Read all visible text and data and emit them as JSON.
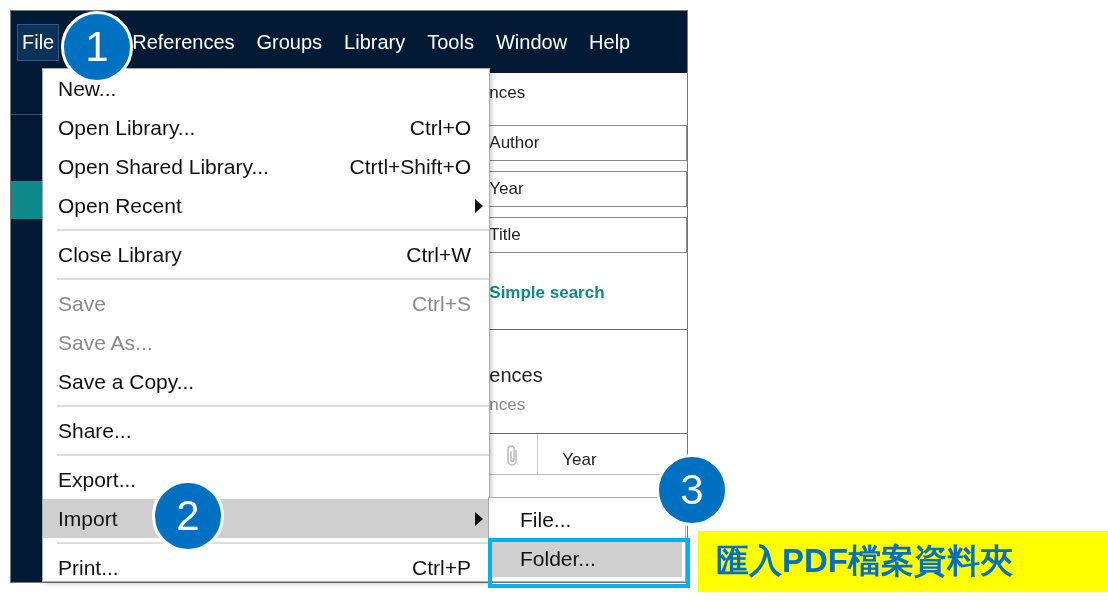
{
  "menu_bar": [
    {
      "label": "File",
      "selected": true
    },
    {
      "label": "References",
      "selected": false
    },
    {
      "label": "Groups",
      "selected": false
    },
    {
      "label": "Library",
      "selected": false
    },
    {
      "label": "Tools",
      "selected": false
    },
    {
      "label": "Window",
      "selected": false
    },
    {
      "label": "Help",
      "selected": false
    }
  ],
  "file_menu": [
    {
      "kind": "item",
      "label": "New...",
      "disabled": false,
      "selected": false,
      "submenu": false
    },
    {
      "kind": "item",
      "label": "Open Library...",
      "shortcut": "Ctrl+O",
      "disabled": false,
      "selected": false,
      "submenu": false
    },
    {
      "kind": "item",
      "label": "Open Shared Library...",
      "shortcut": "Ctrtl+Shift+O",
      "disabled": false,
      "selected": false,
      "submenu": false
    },
    {
      "kind": "item",
      "label": "Open Recent",
      "disabled": false,
      "selected": false,
      "submenu": true
    },
    {
      "kind": "separator"
    },
    {
      "kind": "item",
      "label": "Close Library",
      "shortcut": "Ctrl+W",
      "disabled": false,
      "selected": false,
      "submenu": false
    },
    {
      "kind": "separator"
    },
    {
      "kind": "item",
      "label": "Save",
      "shortcut": "Ctrl+S",
      "disabled": true,
      "selected": false,
      "submenu": false
    },
    {
      "kind": "item",
      "label": "Save As...",
      "disabled": true,
      "selected": false,
      "submenu": false
    },
    {
      "kind": "item",
      "label": "Save a Copy...",
      "disabled": false,
      "selected": false,
      "submenu": false
    },
    {
      "kind": "separator"
    },
    {
      "kind": "item",
      "label": "Share...",
      "disabled": false,
      "selected": false,
      "submenu": false
    },
    {
      "kind": "separator"
    },
    {
      "kind": "item",
      "label": "Export...",
      "disabled": false,
      "selected": false,
      "submenu": false
    },
    {
      "kind": "item",
      "label": "Import",
      "disabled": false,
      "selected": true,
      "submenu": true
    },
    {
      "kind": "separator"
    },
    {
      "kind": "item",
      "label": "Print...",
      "shortcut": "Ctrl+P",
      "disabled": false,
      "selected": false,
      "submenu": false
    }
  ],
  "import_submenu": [
    {
      "label": "File...",
      "selected": false,
      "outlined": false
    },
    {
      "label": "Folder...",
      "selected": true,
      "outlined": true
    }
  ],
  "right_pane": {
    "heading": "nces",
    "fields": [
      "Author",
      "Year",
      "Title"
    ],
    "search_link": "Simple search",
    "group_title": "ences",
    "group_subtitle": "nces",
    "column_header": "Year"
  },
  "callouts": [
    "1",
    "2",
    "3"
  ],
  "note": "匯入PDF檔案資料夾"
}
